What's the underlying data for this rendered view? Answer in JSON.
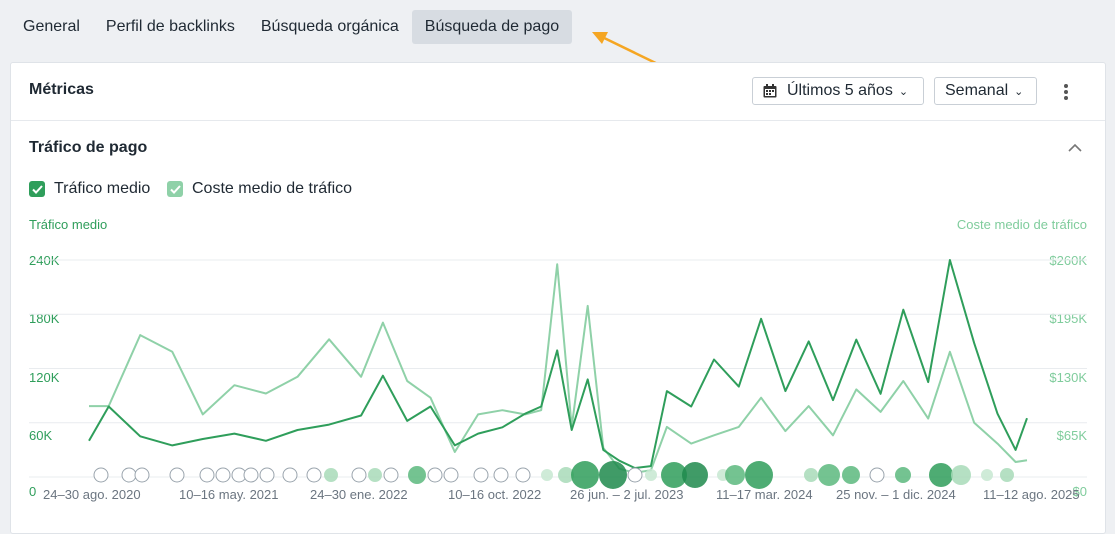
{
  "tabs": [
    "General",
    "Perfil de backlinks",
    "Búsqueda orgánica",
    "Búsqueda de pago"
  ],
  "active_tab": "Búsqueda de pago",
  "panel": {
    "title": "Métricas",
    "date_range": "Últimos 5 años",
    "interval": "Semanal",
    "section_title": "Tráfico de pago"
  },
  "legend": {
    "series1": "Tráfico medio",
    "series2": "Coste medio de tráfico"
  },
  "colors": {
    "traffic": "#2f9e5b",
    "cost": "#8fd1a8",
    "arrow": "#f5a623"
  },
  "chart_data": {
    "type": "line",
    "y_left_label": "Tráfico medio",
    "y_right_label": "Coste medio de tráfico",
    "y_left_ticks": [
      "0",
      "60K",
      "120K",
      "180K",
      "240K"
    ],
    "y_right_ticks": [
      "$0",
      "$65K",
      "$130K",
      "$195K",
      "$260K"
    ],
    "ylim_left": [
      0,
      240000
    ],
    "ylim_right": [
      0,
      260000
    ],
    "x_tick_labels": [
      "24–30 ago. 2020",
      "10–16 may. 2021",
      "24–30 ene. 2022",
      "10–16 oct. 2022",
      "26 jun. – 2 jul. 2023",
      "11–17 mar. 2024",
      "25 nov. – 1 dic. 2024",
      "11–12 ago. 2025"
    ],
    "x": [
      "2020-08-24",
      "2020-10-01",
      "2020-12-01",
      "2021-02-01",
      "2021-04-01",
      "2021-06-01",
      "2021-08-01",
      "2021-10-01",
      "2021-12-01",
      "2022-02-01",
      "2022-03-15",
      "2022-05-01",
      "2022-06-15",
      "2022-08-01",
      "2022-09-15",
      "2022-11-01",
      "2022-12-15",
      "2023-01-15",
      "2023-02-15",
      "2023-03-15",
      "2023-04-15",
      "2023-05-15",
      "2023-06-15",
      "2023-07-15",
      "2023-08-15",
      "2023-09-15",
      "2023-11-01",
      "2023-12-15",
      "2024-02-01",
      "2024-03-15",
      "2024-05-01",
      "2024-06-15",
      "2024-08-01",
      "2024-09-15",
      "2024-11-01",
      "2024-12-15",
      "2025-02-01",
      "2025-03-15",
      "2025-05-01",
      "2025-06-15",
      "2025-07-20",
      "2025-08-11"
    ],
    "series": [
      {
        "name": "Tráfico medio",
        "axis": "left",
        "values": [
          40000,
          78000,
          45000,
          35000,
          42000,
          48000,
          40000,
          52000,
          58000,
          68000,
          112000,
          62000,
          78000,
          35000,
          48000,
          55000,
          70000,
          78000,
          140000,
          52000,
          108000,
          30000,
          18000,
          10000,
          12000,
          95000,
          78000,
          130000,
          100000,
          175000,
          95000,
          150000,
          85000,
          152000,
          92000,
          185000,
          105000,
          240000,
          148000,
          70000,
          30000,
          65000
        ]
      },
      {
        "name": "Coste medio de tráfico",
        "axis": "right",
        "values": [
          85000,
          85000,
          170000,
          150000,
          75000,
          110000,
          100000,
          120000,
          165000,
          120000,
          185000,
          115000,
          95000,
          30000,
          75000,
          80000,
          75000,
          80000,
          255000,
          60000,
          205000,
          35000,
          10000,
          5000,
          8000,
          60000,
          40000,
          50000,
          60000,
          95000,
          55000,
          85000,
          50000,
          105000,
          78000,
          115000,
          70000,
          150000,
          65000,
          40000,
          18000,
          20000
        ]
      }
    ],
    "grid": true,
    "events_row": true
  }
}
